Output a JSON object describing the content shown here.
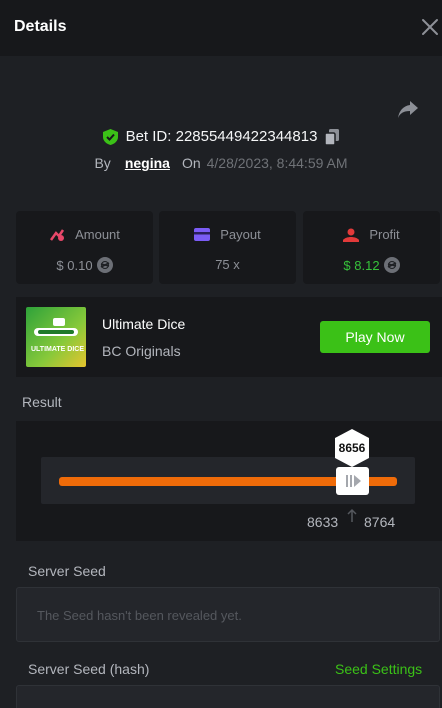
{
  "header": {
    "title": "Details",
    "close_icon": "close-icon"
  },
  "share_icon": "share-arrow-icon",
  "bet": {
    "id_label": "Bet ID: 22855449422344813",
    "by_label": "By",
    "user": "negina",
    "on_label": "On",
    "date": "4/28/2023, 8:44:59 AM"
  },
  "stats": {
    "amount": {
      "label": "Amount",
      "value": "$ 0.10"
    },
    "payout": {
      "label": "Payout",
      "value": "75 x"
    },
    "profit": {
      "label": "Profit",
      "value": "$ 8.12"
    }
  },
  "game": {
    "thumb_text": "ULTIMATE DICE",
    "name": "Ultimate Dice",
    "provider": "BC Originals",
    "play_label": "Play Now"
  },
  "result": {
    "label": "Result",
    "value": "8656",
    "range_low": "8633",
    "range_high": "8764"
  },
  "server_seed": {
    "label": "Server Seed",
    "placeholder": "The Seed hasn't been revealed yet."
  },
  "server_seed_hash": {
    "label": "Server Seed (hash)",
    "settings_label": "Seed Settings"
  },
  "colors": {
    "accent_green": "#3bc117",
    "track_orange": "#ef6b09",
    "amount_icon": "#e8486a",
    "payout_icon": "#7b5cf5",
    "profit_icon": "#e23a3a"
  }
}
